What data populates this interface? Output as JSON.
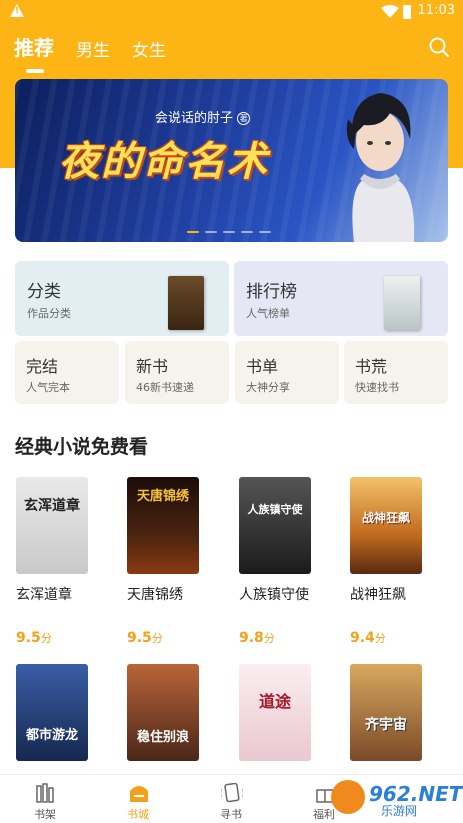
{
  "status_bar": {
    "time": "11:03"
  },
  "tabs": [
    {
      "label": "推荐",
      "active": true
    },
    {
      "label": "男生",
      "active": false
    },
    {
      "label": "女生",
      "active": false
    }
  ],
  "banner": {
    "author": "会说话的肘子",
    "author_badge": "著",
    "title": "夜的命名术",
    "slide_count": 5,
    "active_slide": 1
  },
  "categories": {
    "large": [
      {
        "title": "分类",
        "subtitle": "作品分类"
      },
      {
        "title": "排行榜",
        "subtitle": "人气榜单"
      }
    ],
    "small": [
      {
        "title": "完结",
        "subtitle": "人气完本"
      },
      {
        "title": "新书",
        "subtitle": "46新书速递"
      },
      {
        "title": "书单",
        "subtitle": "大神分享"
      },
      {
        "title": "书荒",
        "subtitle": "快速找书"
      }
    ]
  },
  "section": {
    "title": "经典小说免费看"
  },
  "books": [
    {
      "name": "玄浑道章",
      "score": "9.5",
      "unit": "分",
      "cover_text": "玄浑道章"
    },
    {
      "name": "天唐锦绣",
      "score": "9.5",
      "unit": "分",
      "cover_text": "天唐锦绣"
    },
    {
      "name": "人族镇守使",
      "score": "9.8",
      "unit": "分",
      "cover_text": "人族镇守使"
    },
    {
      "name": "战神狂飙",
      "score": "9.4",
      "unit": "分",
      "cover_text": "战神狂飙"
    }
  ],
  "books_row2": [
    {
      "cover_text": "都市游龙"
    },
    {
      "cover_text": "稳住别浪"
    },
    {
      "cover_text": "道途"
    },
    {
      "cover_text": "齐宇宙"
    }
  ],
  "bottom_nav": [
    {
      "label": "书架",
      "icon": "bookshelf-icon",
      "active": false
    },
    {
      "label": "书城",
      "icon": "bookstore-icon",
      "active": true
    },
    {
      "label": "寻书",
      "icon": "find-book-icon",
      "active": false
    },
    {
      "label": "福利",
      "icon": "gift-icon",
      "active": false
    }
  ],
  "watermark": {
    "text": "962.NET",
    "sub": "乐游网"
  },
  "colors": {
    "brand": "#fdb515",
    "score": "#f1a21a"
  }
}
